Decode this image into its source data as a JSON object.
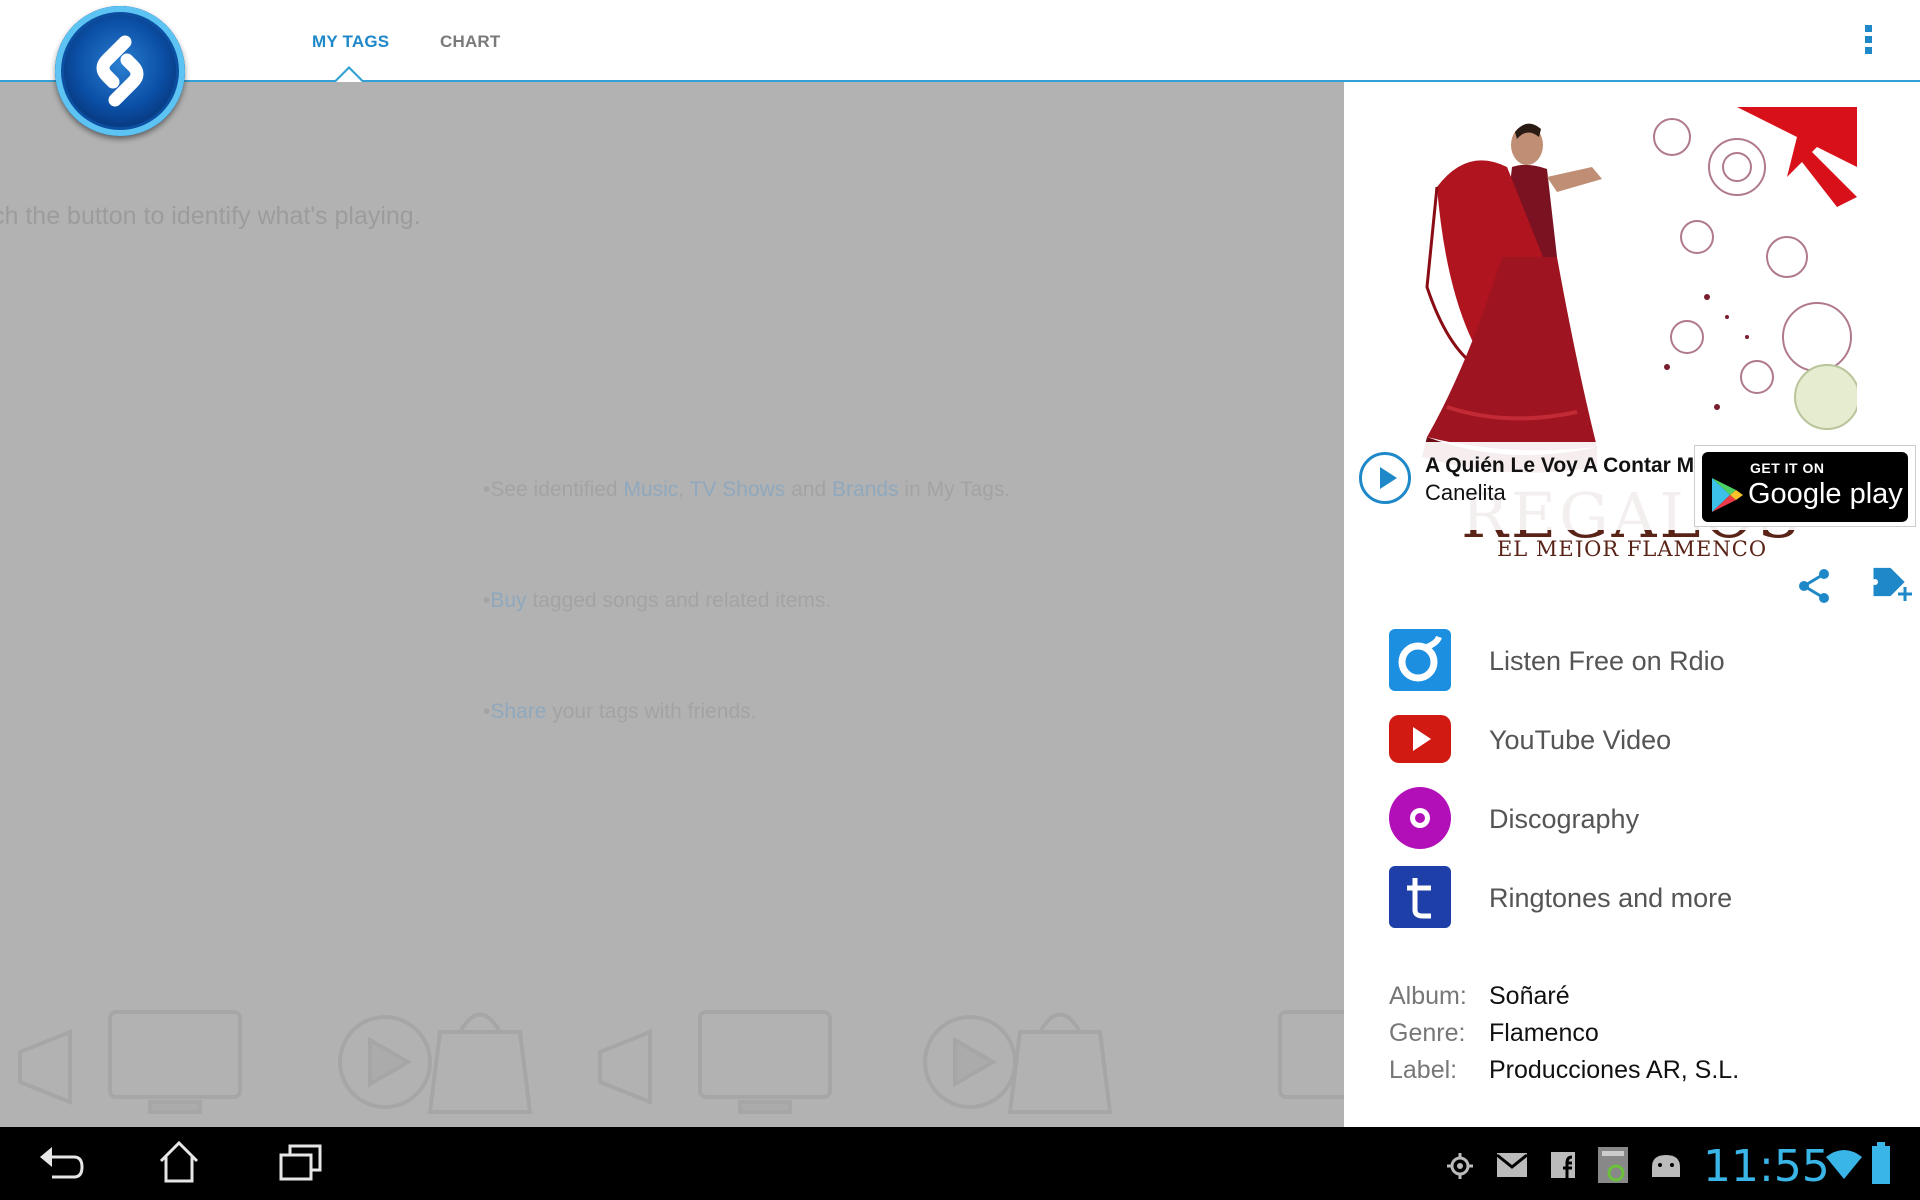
{
  "tabs": [
    {
      "label": "MY TAGS",
      "active": true
    },
    {
      "label": "CHART",
      "active": false
    }
  ],
  "background": {
    "hint": "ch the button to identify what's playing.",
    "bullets": [
      {
        "parts": [
          "•See identified ",
          "Music",
          ", ",
          "TV Shows",
          " and ",
          "Brands",
          " in My Tags."
        ]
      },
      {
        "parts": [
          "•",
          "Buy",
          " tagged songs and related items."
        ]
      },
      {
        "parts": [
          "•",
          "Share",
          " your tags with friends."
        ]
      }
    ]
  },
  "album_art": {
    "caption_big": "REGALOS",
    "caption_small": "EL MEJOR FLAMENCO"
  },
  "now_playing": {
    "title": "A Quién Le Voy A Contar Mi Pena",
    "artist": "Canelita"
  },
  "google_play": {
    "small": "GET IT ON",
    "big": "Google play"
  },
  "actions": [
    {
      "label": "Listen Free on Rdio",
      "icon": "rdio-icon",
      "color": "#1d8fe0"
    },
    {
      "label": "YouTube Video",
      "icon": "youtube-icon",
      "color": "#d11a12"
    },
    {
      "label": "Discography",
      "icon": "discography-icon",
      "color": "#b30fb8"
    },
    {
      "label": "Ringtones and more",
      "icon": "ringtones-icon",
      "color": "#1f3fa8"
    }
  ],
  "details": {
    "album_key": "Album:",
    "album": "Soñaré",
    "genre_key": "Genre:",
    "genre": "Flamenco",
    "label_key": "Label:",
    "label": "Producciones AR, S.L."
  },
  "status": {
    "time": "11:55"
  },
  "colors": {
    "accent": "#1e88c8",
    "clock": "#39b5e8"
  }
}
